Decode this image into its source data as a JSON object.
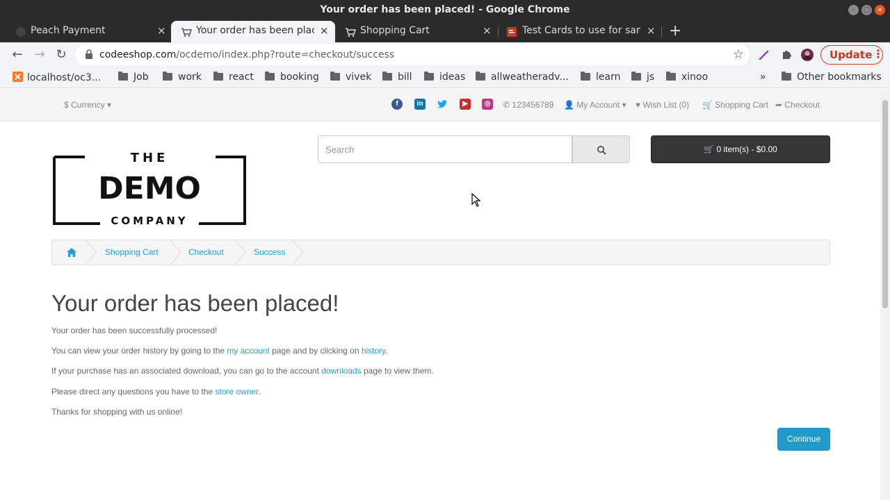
{
  "window": {
    "title": "Your order has been placed! - Google Chrome"
  },
  "tabs": [
    {
      "label": "Peach Payment"
    },
    {
      "label": "Your order has been placed!"
    },
    {
      "label": "Shopping Cart"
    },
    {
      "label": "Test Cards to use for sandbox"
    }
  ],
  "toolbar": {
    "url_domain": "codeeshop.com",
    "url_path": "/ocdemo/index.php?route=checkout/success",
    "update_label": "Update"
  },
  "bookmarks": [
    "localhost/oc3...",
    "Job",
    "work",
    "react",
    "booking",
    "vivek",
    "bill",
    "ideas",
    "allweatheradv...",
    "learn",
    "js",
    "xinoo"
  ],
  "bookmarks_more": "»",
  "bookmarks_other": "Other bookmarks",
  "topnav": {
    "currency": "$ Currency",
    "phone": "123456789",
    "my_account": "My Account",
    "wish_list": "Wish List (0)",
    "shopping_cart": "Shopping Cart",
    "checkout": "Checkout"
  },
  "social_icons": [
    "facebook-icon",
    "linkedin-icon",
    "twitter-icon",
    "youtube-icon",
    "instagram-icon"
  ],
  "logo": {
    "line1": "THE",
    "line2": "DEMO",
    "line3": "COMPANY"
  },
  "search": {
    "placeholder": "Search"
  },
  "cart": {
    "label": "0 item(s) - $0.00"
  },
  "breadcrumb": [
    "Shopping Cart",
    "Checkout",
    "Success"
  ],
  "content": {
    "heading": "Your order has been placed!",
    "p1": "Your order has been successfully processed!",
    "p2_a": "You can view your order history by going to the ",
    "p2_link1": "my account",
    "p2_b": " page and by clicking on ",
    "p2_link2": "history",
    "p2_c": ".",
    "p3_a": "If your purchase has an associated download, you can go to the account ",
    "p3_link": "downloads",
    "p3_b": " page to view them.",
    "p4_a": "Please direct any questions you have to the ",
    "p4_link": "store owner",
    "p4_b": ".",
    "p5": "Thanks for shopping with us online!",
    "continue_label": "Continue"
  },
  "colors": {
    "link": "#23a1d1",
    "button_primary": "#229ac8",
    "cart_bg": "#363636",
    "update_red": "#d93025"
  }
}
